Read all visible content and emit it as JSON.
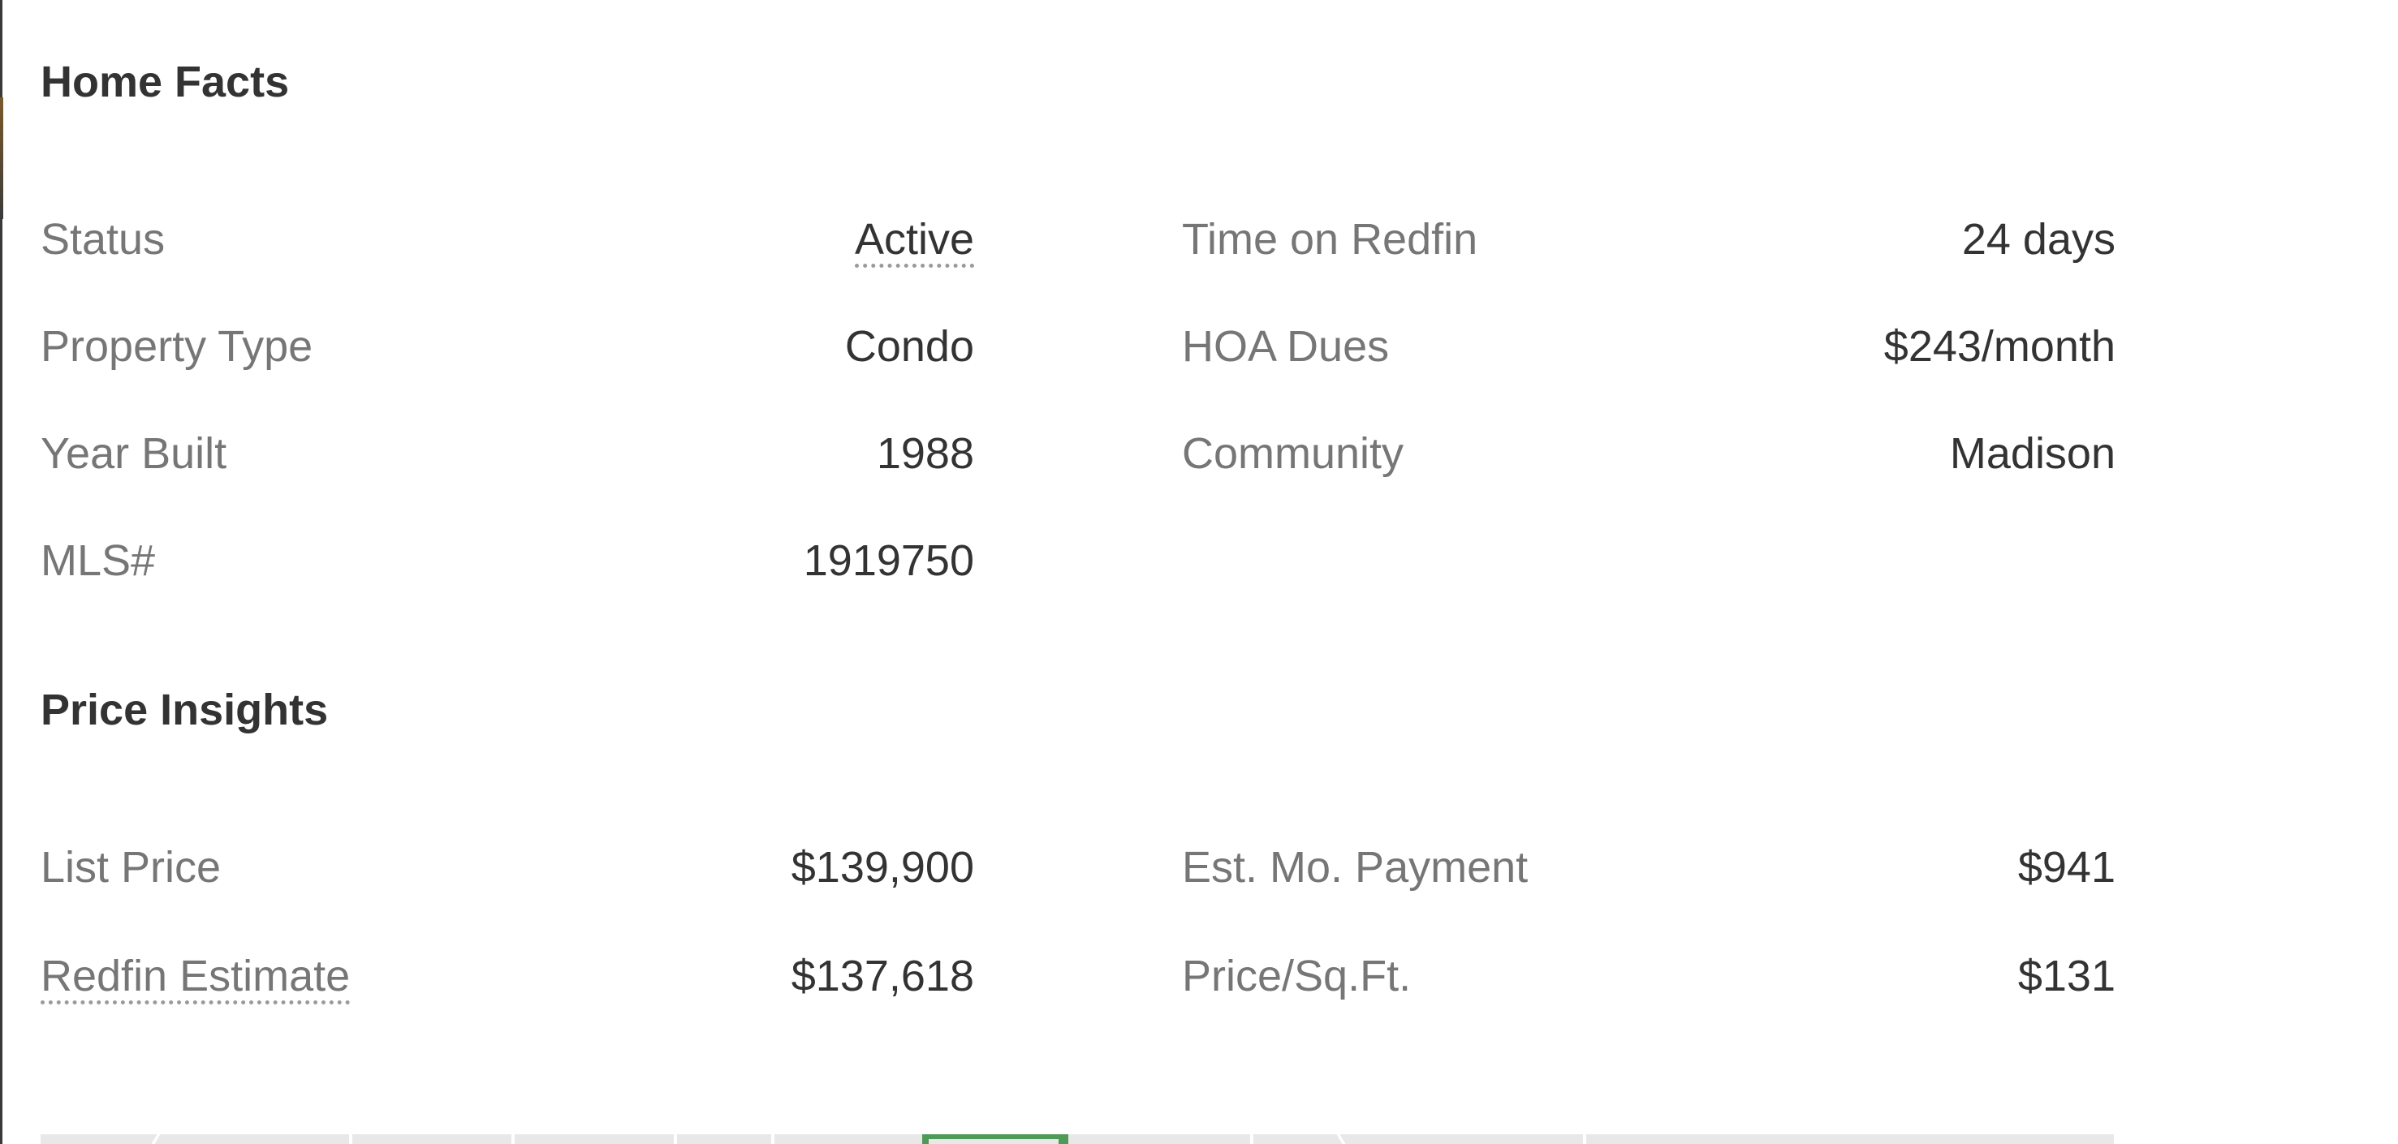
{
  "home_facts": {
    "title": "Home Facts",
    "rows_left": [
      {
        "label": "Status",
        "value": "Active"
      },
      {
        "label": "Property Type",
        "value": "Condo"
      },
      {
        "label": "Year Built",
        "value": "1988"
      },
      {
        "label": "MLS#",
        "value": "1919750"
      }
    ],
    "rows_right": [
      {
        "label": "Time on Redfin",
        "value": "24 days"
      },
      {
        "label": "HOA Dues",
        "value": "$243/month"
      },
      {
        "label": "Community",
        "value": "Madison"
      }
    ]
  },
  "price_insights": {
    "title": "Price Insights",
    "rows_left": [
      {
        "label": "List Price",
        "value": "$139,900"
      },
      {
        "label": "Redfin Estimate",
        "value": "$137,618"
      }
    ],
    "rows_right": [
      {
        "label": "Est. Mo. Payment",
        "value": "$941"
      },
      {
        "label": "Price/Sq.Ft.",
        "value": "$131"
      }
    ]
  },
  "map_preview": {
    "road_color": "#ffffff",
    "park_color": "#4e9a57"
  }
}
